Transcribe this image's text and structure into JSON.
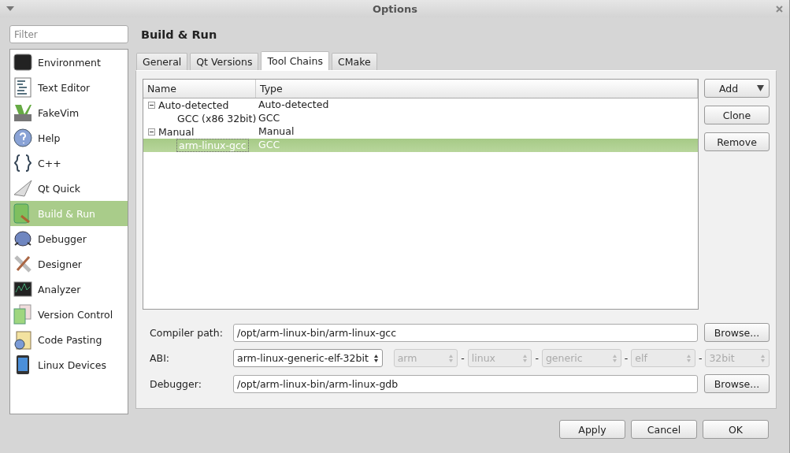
{
  "window": {
    "title": "Options"
  },
  "filter": {
    "placeholder": "Filter"
  },
  "sidebar": {
    "items": [
      {
        "label": "Environment",
        "selected": false
      },
      {
        "label": "Text Editor",
        "selected": false
      },
      {
        "label": "FakeVim",
        "selected": false
      },
      {
        "label": "Help",
        "selected": false
      },
      {
        "label": "C++",
        "selected": false
      },
      {
        "label": "Qt Quick",
        "selected": false
      },
      {
        "label": "Build & Run",
        "selected": true
      },
      {
        "label": "Debugger",
        "selected": false
      },
      {
        "label": "Designer",
        "selected": false
      },
      {
        "label": "Analyzer",
        "selected": false
      },
      {
        "label": "Version Control",
        "selected": false
      },
      {
        "label": "Code Pasting",
        "selected": false
      },
      {
        "label": "Linux Devices",
        "selected": false
      }
    ]
  },
  "page_title": "Build & Run",
  "tabs": [
    {
      "label": "General",
      "selected": false
    },
    {
      "label": "Qt Versions",
      "selected": false
    },
    {
      "label": "Tool Chains",
      "selected": true
    },
    {
      "label": "CMake",
      "selected": false
    }
  ],
  "toolchains": {
    "columns": [
      "Name",
      "Type"
    ],
    "rows": [
      {
        "name": "Auto-detected",
        "type": "Auto-detected",
        "expanded": true,
        "selected": false,
        "children": [
          {
            "name": "GCC (x86 32bit)",
            "type": "GCC",
            "selected": false
          }
        ]
      },
      {
        "name": "Manual",
        "type": "Manual",
        "expanded": true,
        "selected": false,
        "children": [
          {
            "name": "arm-linux-gcc",
            "type": "GCC",
            "selected": true
          }
        ]
      }
    ]
  },
  "side_buttons": [
    {
      "label": "Add",
      "kind": "menu"
    },
    {
      "label": "Clone",
      "kind": "plain"
    },
    {
      "label": "Remove",
      "kind": "plain"
    }
  ],
  "form": {
    "compiler_path": {
      "label": "Compiler path:",
      "value": "/opt/arm-linux-bin/arm-linux-gcc",
      "button": "Browse..."
    },
    "abi": {
      "label": "ABI:",
      "value": "arm-linux-generic-elf-32bit",
      "parts": [
        {
          "value": "arm",
          "disabled": true
        },
        {
          "value": "linux",
          "disabled": true
        },
        {
          "value": "generic",
          "disabled": true
        },
        {
          "value": "elf",
          "disabled": true
        },
        {
          "value": "32bit",
          "disabled": true
        }
      ],
      "separators": [
        "-",
        "-",
        "-",
        "-"
      ]
    },
    "debugger": {
      "label": "Debugger:",
      "value": "/opt/arm-linux-bin/arm-linux-gdb",
      "button": "Browse..."
    }
  },
  "footer_buttons": [
    "Apply",
    "Cancel",
    "OK"
  ]
}
